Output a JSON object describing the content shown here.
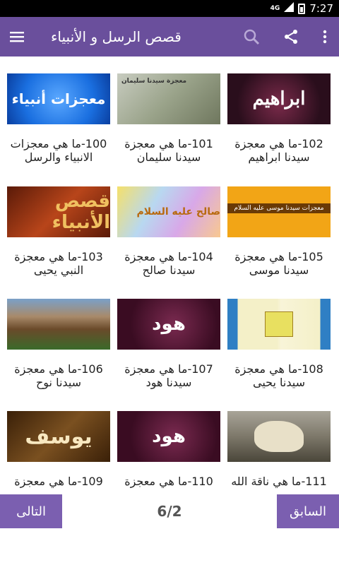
{
  "status": {
    "signal": "4G",
    "time": "7:27"
  },
  "appbar": {
    "title": "قصص الرسل و الأنبياء"
  },
  "thumbs": {
    "t0": "معجزات أنبياء",
    "t1": "معجزة سيدنا سليمان",
    "t2": "ابراهيم",
    "t3": "قصص الأنبياء",
    "t4": "صالح عليه السلام",
    "t5": "معجزات سيدنا موسى عليه السلام",
    "t7": "هود",
    "t10": "هود",
    "t9": "يوسف"
  },
  "items": [
    {
      "line1": "100-ما هي معجزات",
      "line2": "الانبياء والرسل",
      "bg": "#1a6fe0"
    },
    {
      "line1": "101-ما هي معجزة",
      "line2": "سيدنا سليمان",
      "bg": "#9aa38a"
    },
    {
      "line1": "102-ما هي معجزة",
      "line2": "سيدنا ابراهيم",
      "bg": "#2a0e1c"
    },
    {
      "line1": "103-ما هي معجزة",
      "line2": "النبي يحيى",
      "bg": "#8a2a10"
    },
    {
      "line1": "104-ما هي معجزة",
      "line2": "سيدنا صالح",
      "bg": "#c9b6d8"
    },
    {
      "line1": "105-ما هي معجزة",
      "line2": "سيدنا موسى",
      "bg": "#f2a516"
    },
    {
      "line1": "106-ما هي معجزة",
      "line2": "سيدنا نوح",
      "bg": "#5a6e3a"
    },
    {
      "line1": "107-ما هي معجزة",
      "line2": "سيدنا هود",
      "bg": "#3a0c22"
    },
    {
      "line1": "108-ما هي معجزة",
      "line2": "سيدنا يحيى",
      "bg": "#2f7fc4"
    },
    {
      "line1": "109-ما هي معجزة",
      "line2": "",
      "bg": "#5a3a10"
    },
    {
      "line1": "110-ما هي معجزة",
      "line2": "",
      "bg": "#3a0c22"
    },
    {
      "line1": "111-ما هي ناقة الله",
      "line2": "",
      "bg": "#7d786a"
    }
  ],
  "nav": {
    "next": "التالى",
    "prev": "السابق",
    "page": "6/2"
  },
  "colors": {
    "appbar": "#6a4f9c",
    "button": "#7b5fb0"
  }
}
